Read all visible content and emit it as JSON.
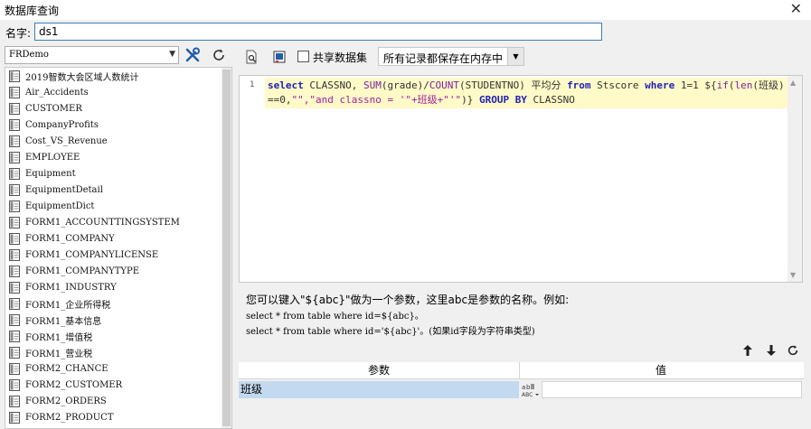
{
  "window": {
    "title": "数据库查询"
  },
  "name_field": {
    "label": "名字:",
    "value": "ds1"
  },
  "datasource": {
    "selected": "FRDemo"
  },
  "tables": [
    "2019智数大会区域人数统计",
    "Air_Accidents",
    "CUSTOMER",
    "CompanyProfits",
    "Cost_VS_Revenue",
    "EMPLOYEE",
    "Equipment",
    "EquipmentDetail",
    "EquipmentDict",
    "FORM1_ACCOUNTTINGSYSTEM",
    "FORM1_COMPANY",
    "FORM1_COMPANYLICENSE",
    "FORM1_COMPANYTYPE",
    "FORM1_INDUSTRY",
    "FORM1_企业所得税",
    "FORM1_基本信息",
    "FORM1_增值税",
    "FORM1_营业税",
    "FORM2_CHANCE",
    "FORM2_CUSTOMER",
    "FORM2_ORDERS",
    "FORM2_PRODUCT"
  ],
  "toolbar": {
    "share_label": "共享数据集",
    "storage_selected": "所有记录都保存在内存中"
  },
  "editor": {
    "line_number": "1",
    "tokens": {
      "t1": "select",
      "t2": " CLASSNO, ",
      "t3": "SUM",
      "t4": "(grade)/",
      "t5": "COUNT",
      "t6": "(STUDENTNO) 平均分 ",
      "t7": "from",
      "t8": " Stscore ",
      "t9": "where",
      "t10": " 1=1 ${",
      "t11": "if",
      "t12": "(",
      "t13": "len",
      "t14": "(班级)==0,",
      "t15": "\"\",\"and classno = '\"+班级+\"'\"",
      "t16": ")} ",
      "t17": "GROUP BY",
      "t18": " CLASSNO"
    }
  },
  "hint": {
    "line1": "您可以键入\"${abc}\"做为一个参数，这里abc是参数的名称。例如:",
    "line2": "select * from table where id=${abc}。",
    "line3": "select * from table where id='${abc}'。(如果id字段为字符串类型)"
  },
  "params": {
    "col_param": "参数",
    "col_value": "值",
    "rows": [
      {
        "name": "班级",
        "value": ""
      }
    ]
  }
}
